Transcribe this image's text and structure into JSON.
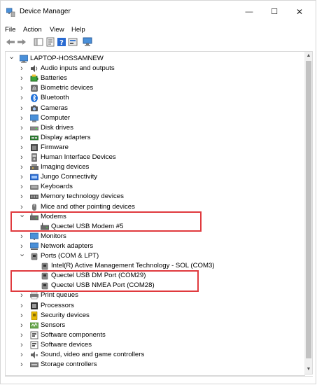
{
  "window": {
    "title": "Device Manager",
    "controls": {
      "minimize": "—",
      "maximize": "☐",
      "close": "✕"
    }
  },
  "menu": [
    "File",
    "Action",
    "View",
    "Help"
  ],
  "tree": {
    "root": "LAPTOP-HOSSAMNEW",
    "items": [
      {
        "label": "Audio inputs and outputs",
        "icon": "speaker-icon",
        "expanded": false
      },
      {
        "label": "Batteries",
        "icon": "battery-icon",
        "expanded": false
      },
      {
        "label": "Biometric devices",
        "icon": "fingerprint-icon",
        "expanded": false
      },
      {
        "label": "Bluetooth",
        "icon": "bluetooth-icon",
        "expanded": false
      },
      {
        "label": "Cameras",
        "icon": "camera-icon",
        "expanded": false
      },
      {
        "label": "Computer",
        "icon": "computer-icon",
        "expanded": false
      },
      {
        "label": "Disk drives",
        "icon": "disk-drive-icon",
        "expanded": false
      },
      {
        "label": "Display adapters",
        "icon": "display-adapter-icon",
        "expanded": false
      },
      {
        "label": "Firmware",
        "icon": "firmware-icon",
        "expanded": false
      },
      {
        "label": "Human Interface Devices",
        "icon": "hid-icon",
        "expanded": false
      },
      {
        "label": "Imaging devices",
        "icon": "imaging-icon",
        "expanded": false
      },
      {
        "label": "Jungo Connectivity",
        "icon": "jungo-icon",
        "expanded": false
      },
      {
        "label": "Keyboards",
        "icon": "keyboard-icon",
        "expanded": false
      },
      {
        "label": "Memory technology devices",
        "icon": "memory-icon",
        "expanded": false
      },
      {
        "label": "Mice and other pointing devices",
        "icon": "mouse-icon",
        "expanded": false
      },
      {
        "label": "Modems",
        "icon": "modem-icon",
        "expanded": true,
        "children": [
          "Quectel USB Modem #5"
        ]
      },
      {
        "label": "Monitors",
        "icon": "monitor-icon",
        "expanded": false
      },
      {
        "label": "Network adapters",
        "icon": "network-icon",
        "expanded": false
      },
      {
        "label": "Ports (COM & LPT)",
        "icon": "port-icon",
        "expanded": true,
        "children": [
          "Intel(R) Active Management Technology - SOL (COM3)",
          "Quectel USB DM Port (COM29)",
          "Quectel USB NMEA Port (COM28)"
        ]
      },
      {
        "label": "Print queues",
        "icon": "printer-icon",
        "expanded": false
      },
      {
        "label": "Processors",
        "icon": "processor-icon",
        "expanded": false
      },
      {
        "label": "Security devices",
        "icon": "security-icon",
        "expanded": false
      },
      {
        "label": "Sensors",
        "icon": "sensor-icon",
        "expanded": false
      },
      {
        "label": "Software components",
        "icon": "software-component-icon",
        "expanded": false
      },
      {
        "label": "Software devices",
        "icon": "software-device-icon",
        "expanded": false
      },
      {
        "label": "Sound, video and game controllers",
        "icon": "sound-icon",
        "expanded": false
      },
      {
        "label": "Storage controllers",
        "icon": "storage-icon",
        "expanded": false
      }
    ]
  },
  "colors": {
    "highlight": "#e03a3e",
    "selection": "#cce8ff"
  }
}
